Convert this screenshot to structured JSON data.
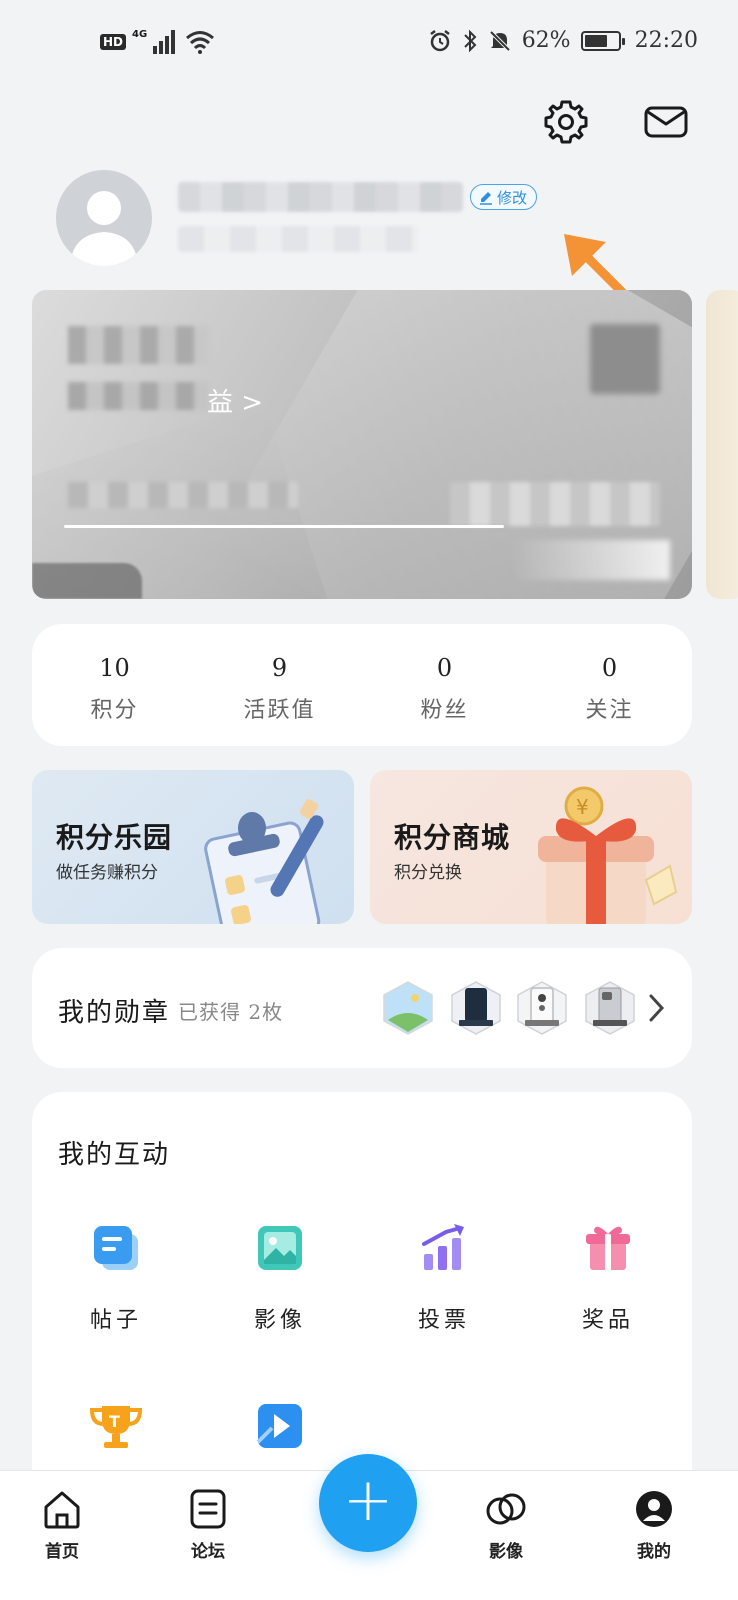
{
  "status_bar": {
    "hd": "HD",
    "network": "4G",
    "battery_percent": "62%",
    "time": "22:20"
  },
  "header": {
    "settings_icon": "gear-icon",
    "mail_icon": "mail-icon"
  },
  "profile": {
    "edit_label": "修改"
  },
  "member_card": {
    "benefit_suffix": "益 >"
  },
  "stats": [
    {
      "value": "10",
      "label": "积分"
    },
    {
      "value": "9",
      "label": "活跃值"
    },
    {
      "value": "0",
      "label": "粉丝"
    },
    {
      "value": "0",
      "label": "关注"
    }
  ],
  "promos": {
    "left": {
      "title": "积分乐园",
      "subtitle": "做任务赚积分"
    },
    "right": {
      "title": "积分商城",
      "subtitle": "积分兑换"
    }
  },
  "badges": {
    "title": "我的勋章",
    "count_text": "已获得 2枚"
  },
  "interactions": {
    "title": "我的互动",
    "items": [
      {
        "label": "帖子",
        "icon": "post-icon"
      },
      {
        "label": "影像",
        "icon": "image-icon"
      },
      {
        "label": "投票",
        "icon": "vote-icon"
      },
      {
        "label": "奖品",
        "icon": "gift-icon"
      },
      {
        "label": "",
        "icon": "trophy-icon"
      },
      {
        "label": "",
        "icon": "video-icon"
      }
    ]
  },
  "tab_bar": {
    "home": "首页",
    "forum": "论坛",
    "add": "+",
    "gallery": "影像",
    "me": "我的"
  },
  "colors": {
    "accent": "#1fa0f0",
    "annotation_arrow": "#f39336"
  }
}
